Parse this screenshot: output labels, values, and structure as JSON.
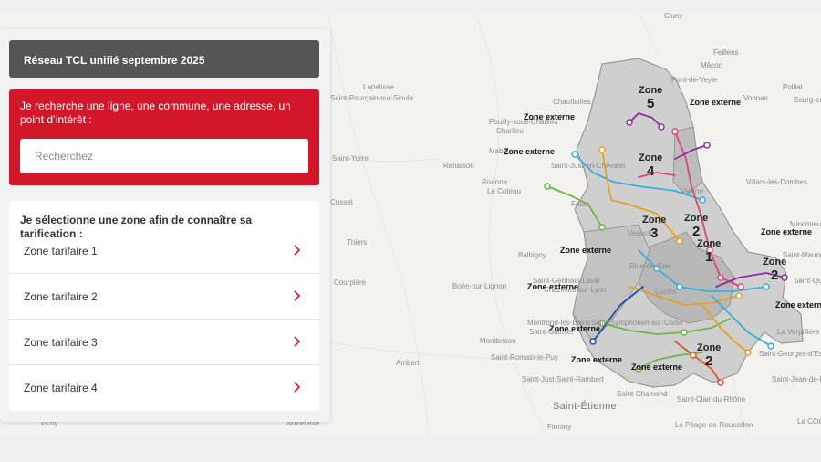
{
  "panel": {
    "network_title": "Réseau TCL unifié septembre 2025",
    "search": {
      "label": "Je recherche une ligne, une commune, une adresse, un point d’intérêt :",
      "placeholder": "Recherchez"
    },
    "zones": {
      "heading": "Je sélectionne une zone afin de connaître sa tarification :",
      "items": [
        {
          "label": "Zone tarifaire 1"
        },
        {
          "label": "Zone tarifaire 2"
        },
        {
          "label": "Zone tarifaire 3"
        },
        {
          "label": "Zone tarifaire 4"
        }
      ]
    }
  },
  "map": {
    "places": [
      "Cluny",
      "Feillens",
      "Mâcon",
      "Pont-de-Veyle",
      "Vonnas",
      "Polliat",
      "Bourg-en-Bresse",
      "Villars-les-Dombes",
      "Meximieux",
      "Saint-Maurice-de-Beynost",
      "Saint-Quentin-Fallavier",
      "La Verpillière",
      "Saint-Georges-d'Espéranche",
      "Saint-Jean-de-Bournay",
      "La Côte-Saint-André",
      "Lapalisse",
      "Renaison",
      "Thiers",
      "Courpière",
      "Boën-sur-Lignon",
      "Montbrison",
      "Ambert",
      "Saint-Romain-le-Puy",
      "Saint-Just-Saint-Rambert",
      "Saint-Chamond",
      "Saint-Étienne",
      "Firminy",
      "Saint-Clair-du-Rhône",
      "Le Péage-de-Roussillon",
      "Balbigny",
      "Saint-Germain-Laval",
      "Chauffailles",
      "Pouilly-sous-Charlieu",
      "Charlieu",
      "Mably",
      "Roanne",
      "Le Coteau",
      "Saint-Yorre",
      "Saint-Pourçain-sur-Sioule",
      "Cusset",
      "Vichy",
      "Montrond-les-Bains",
      "Saint-Galmier",
      "Veauche",
      "Chazelles-sur-Lyon",
      "Feurs",
      "Saint-Just-en-Chevalet",
      "Noirétable",
      "Saint-Symphorien-sur-Coise",
      "Rive-de-Gier",
      "Givors",
      "Vienne"
    ],
    "zone_labels": [
      {
        "name": "Zone",
        "num": "1"
      },
      {
        "name": "Zone",
        "num": "2"
      },
      {
        "name": "Zone",
        "num": "3"
      },
      {
        "name": "Zone",
        "num": "4"
      },
      {
        "name": "Zone",
        "num": "5"
      },
      {
        "name": "Zone",
        "num": "2"
      },
      {
        "name": "Zone",
        "num": "2"
      }
    ],
    "external_label": "Zone externe",
    "line_colors": [
      "#8e2f9a",
      "#3aaed8",
      "#e8a020",
      "#69b844",
      "#e0457b",
      "#e2552a",
      "#1f4ea3",
      "#b5b5b5"
    ]
  }
}
